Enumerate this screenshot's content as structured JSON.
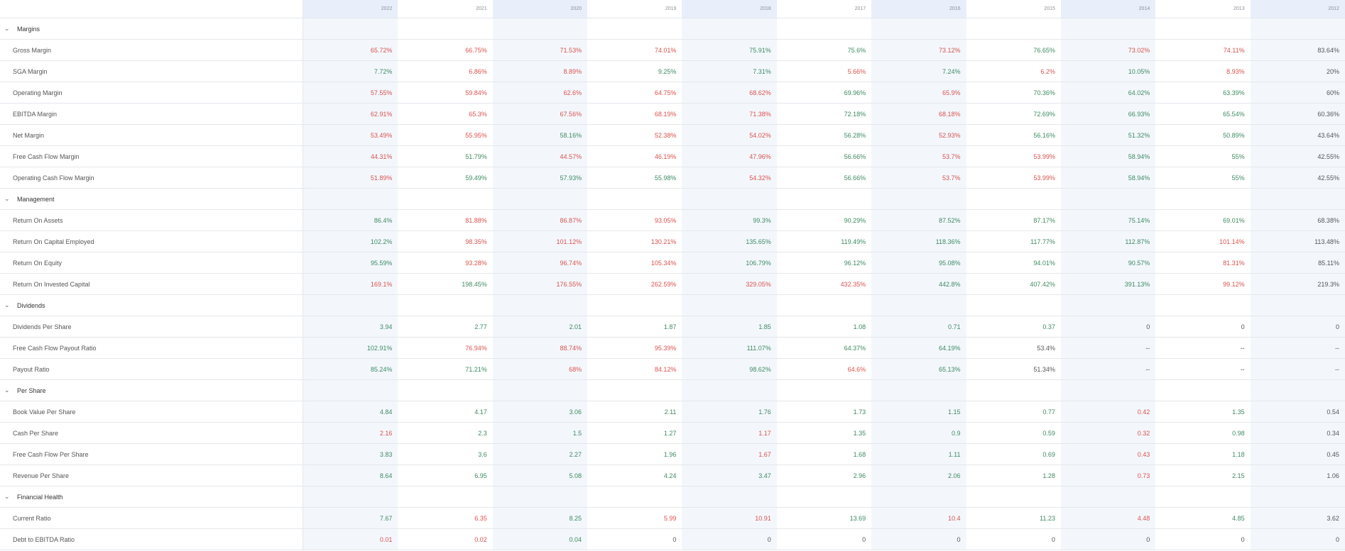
{
  "colors": {
    "positive": "#3f8a62",
    "negative": "#d9534f",
    "neutral": "#555555",
    "shade": "#f3f7fc"
  },
  "years": [
    "2022",
    "2021",
    "2020",
    "2019",
    "2018",
    "2017",
    "2016",
    "2015",
    "2014",
    "2013",
    "2012"
  ],
  "sections": [
    {
      "title": "Margins",
      "icon": "chevron-down-icon",
      "rows": [
        {
          "label": "Gross Margin",
          "values": [
            "65.72%",
            "66.75%",
            "71.53%",
            "74.01%",
            "75.91%",
            "75.6%",
            "73.12%",
            "76.65%",
            "73.02%",
            "74.11%",
            "83.64%"
          ],
          "tones": [
            "neg",
            "neg",
            "neg",
            "neg",
            "pos",
            "pos",
            "neg",
            "pos",
            "neg",
            "neg",
            "neu"
          ]
        },
        {
          "label": "SGA Margin",
          "values": [
            "7.72%",
            "6.86%",
            "8.89%",
            "9.25%",
            "7.31%",
            "5.66%",
            "7.24%",
            "6.2%",
            "10.05%",
            "8.93%",
            "20%"
          ],
          "tones": [
            "pos",
            "neg",
            "neg",
            "pos",
            "pos",
            "neg",
            "pos",
            "neg",
            "pos",
            "neg",
            "neu"
          ]
        },
        {
          "label": "Operating Margin",
          "values": [
            "57.55%",
            "59.84%",
            "62.6%",
            "64.75%",
            "68.62%",
            "69.96%",
            "65.9%",
            "70.36%",
            "64.02%",
            "63.39%",
            "60%"
          ],
          "tones": [
            "neg",
            "neg",
            "neg",
            "neg",
            "neg",
            "pos",
            "neg",
            "pos",
            "pos",
            "pos",
            "neu"
          ]
        },
        {
          "label": "EBITDA Margin",
          "values": [
            "62.91%",
            "65.3%",
            "67.56%",
            "68.19%",
            "71.38%",
            "72.18%",
            "68.18%",
            "72.69%",
            "66.93%",
            "65.54%",
            "60.36%"
          ],
          "tones": [
            "neg",
            "neg",
            "neg",
            "neg",
            "neg",
            "pos",
            "neg",
            "pos",
            "pos",
            "pos",
            "neu"
          ]
        },
        {
          "label": "Net Margin",
          "values": [
            "53.49%",
            "55.95%",
            "58.16%",
            "52.38%",
            "54.02%",
            "56.28%",
            "52.93%",
            "56.16%",
            "51.32%",
            "50.89%",
            "43.64%"
          ],
          "tones": [
            "neg",
            "neg",
            "pos",
            "neg",
            "neg",
            "pos",
            "neg",
            "pos",
            "pos",
            "pos",
            "neu"
          ]
        },
        {
          "label": "Free Cash Flow Margin",
          "values": [
            "44.31%",
            "51.79%",
            "44.57%",
            "46.19%",
            "47.96%",
            "56.66%",
            "53.7%",
            "53.99%",
            "58.94%",
            "55%",
            "42.55%"
          ],
          "tones": [
            "neg",
            "pos",
            "neg",
            "neg",
            "neg",
            "pos",
            "neg",
            "neg",
            "pos",
            "pos",
            "neu"
          ]
        },
        {
          "label": "Operating Cash Flow Margin",
          "values": [
            "51.89%",
            "59.49%",
            "57.93%",
            "55.98%",
            "54.32%",
            "56.66%",
            "53.7%",
            "53.99%",
            "58.94%",
            "55%",
            "42.55%"
          ],
          "tones": [
            "neg",
            "pos",
            "pos",
            "pos",
            "neg",
            "pos",
            "neg",
            "neg",
            "pos",
            "pos",
            "neu"
          ]
        }
      ]
    },
    {
      "title": "Management",
      "icon": "chevron-down-icon",
      "rows": [
        {
          "label": "Return On Assets",
          "values": [
            "86.4%",
            "81.88%",
            "86.87%",
            "93.05%",
            "99.3%",
            "90.29%",
            "87.52%",
            "87.17%",
            "75.14%",
            "69.01%",
            "68.38%"
          ],
          "tones": [
            "pos",
            "neg",
            "neg",
            "neg",
            "pos",
            "pos",
            "pos",
            "pos",
            "pos",
            "pos",
            "neu"
          ]
        },
        {
          "label": "Return On Capital Employed",
          "values": [
            "102.2%",
            "98.35%",
            "101.12%",
            "130.21%",
            "135.65%",
            "119.49%",
            "118.36%",
            "117.77%",
            "112.87%",
            "101.14%",
            "113.48%"
          ],
          "tones": [
            "pos",
            "neg",
            "neg",
            "neg",
            "pos",
            "pos",
            "pos",
            "pos",
            "pos",
            "neg",
            "neu"
          ]
        },
        {
          "label": "Return On Equity",
          "values": [
            "95.59%",
            "93.28%",
            "96.74%",
            "105.34%",
            "106.79%",
            "96.12%",
            "95.08%",
            "94.01%",
            "90.57%",
            "81.31%",
            "85.11%"
          ],
          "tones": [
            "pos",
            "neg",
            "neg",
            "neg",
            "pos",
            "pos",
            "pos",
            "pos",
            "pos",
            "neg",
            "neu"
          ]
        },
        {
          "label": "Return On Invested Capital",
          "values": [
            "169.1%",
            "198.45%",
            "176.55%",
            "262.59%",
            "329.05%",
            "432.35%",
            "442.8%",
            "407.42%",
            "391.13%",
            "99.12%",
            "219.3%"
          ],
          "tones": [
            "neg",
            "pos",
            "neg",
            "neg",
            "neg",
            "neg",
            "pos",
            "pos",
            "pos",
            "neg",
            "neu"
          ]
        }
      ]
    },
    {
      "title": "Dividends",
      "icon": "chevron-down-icon",
      "rows": [
        {
          "label": "Dividends Per Share",
          "values": [
            "3.94",
            "2.77",
            "2.01",
            "1.87",
            "1.85",
            "1.08",
            "0.71",
            "0.37",
            "0",
            "0",
            "0"
          ],
          "tones": [
            "pos",
            "pos",
            "pos",
            "pos",
            "pos",
            "pos",
            "pos",
            "pos",
            "neu",
            "neu",
            "neu"
          ]
        },
        {
          "label": "Free Cash Flow Payout Ratio",
          "values": [
            "102.91%",
            "76.94%",
            "88.74%",
            "95.39%",
            "111.07%",
            "64.37%",
            "64.19%",
            "53.4%",
            "--",
            "--",
            "--"
          ],
          "tones": [
            "pos",
            "neg",
            "neg",
            "neg",
            "pos",
            "pos",
            "pos",
            "neu",
            "neu",
            "neu",
            "neu"
          ]
        },
        {
          "label": "Payout Ratio",
          "values": [
            "85.24%",
            "71.21%",
            "68%",
            "84.12%",
            "98.62%",
            "64.6%",
            "65.13%",
            "51.34%",
            "--",
            "--",
            "--"
          ],
          "tones": [
            "pos",
            "pos",
            "neg",
            "neg",
            "pos",
            "neg",
            "pos",
            "neu",
            "neu",
            "neu",
            "neu"
          ]
        }
      ]
    },
    {
      "title": "Per Share",
      "icon": "chevron-down-icon",
      "rows": [
        {
          "label": "Book Value Per Share",
          "values": [
            "4.84",
            "4.17",
            "3.06",
            "2.11",
            "1.76",
            "1.73",
            "1.15",
            "0.77",
            "0.42",
            "1.35",
            "0.54"
          ],
          "tones": [
            "pos",
            "pos",
            "pos",
            "pos",
            "pos",
            "pos",
            "pos",
            "pos",
            "neg",
            "pos",
            "neu"
          ]
        },
        {
          "label": "Cash Per Share",
          "values": [
            "2.16",
            "2.3",
            "1.5",
            "1.27",
            "1.17",
            "1.35",
            "0.9",
            "0.59",
            "0.32",
            "0.98",
            "0.34"
          ],
          "tones": [
            "neg",
            "pos",
            "pos",
            "pos",
            "neg",
            "pos",
            "pos",
            "pos",
            "neg",
            "pos",
            "neu"
          ]
        },
        {
          "label": "Free Cash Flow Per Share",
          "values": [
            "3.83",
            "3.6",
            "2.27",
            "1.96",
            "1.67",
            "1.68",
            "1.11",
            "0.69",
            "0.43",
            "1.18",
            "0.45"
          ],
          "tones": [
            "pos",
            "pos",
            "pos",
            "pos",
            "neg",
            "pos",
            "pos",
            "pos",
            "neg",
            "pos",
            "neu"
          ]
        },
        {
          "label": "Revenue Per Share",
          "values": [
            "8.64",
            "6.95",
            "5.08",
            "4.24",
            "3.47",
            "2.96",
            "2.06",
            "1.28",
            "0.73",
            "2.15",
            "1.06"
          ],
          "tones": [
            "pos",
            "pos",
            "pos",
            "pos",
            "pos",
            "pos",
            "pos",
            "pos",
            "neg",
            "pos",
            "neu"
          ]
        }
      ]
    },
    {
      "title": "Financial Health",
      "icon": "chevron-down-icon",
      "rows": [
        {
          "label": "Current Ratio",
          "values": [
            "7.67",
            "6.35",
            "8.25",
            "5.99",
            "10.91",
            "13.69",
            "10.4",
            "11.23",
            "4.48",
            "4.85",
            "3.62"
          ],
          "tones": [
            "pos",
            "neg",
            "pos",
            "neg",
            "neg",
            "pos",
            "neg",
            "pos",
            "neg",
            "pos",
            "neu"
          ]
        },
        {
          "label": "Debt to EBITDA Ratio",
          "values": [
            "0.01",
            "0.02",
            "0.04",
            "0",
            "0",
            "0",
            "0",
            "0",
            "0",
            "0",
            "0"
          ],
          "tones": [
            "neg",
            "neg",
            "pos",
            "neu",
            "neu",
            "neu",
            "neu",
            "neu",
            "neu",
            "neu",
            "neu"
          ]
        }
      ]
    }
  ]
}
